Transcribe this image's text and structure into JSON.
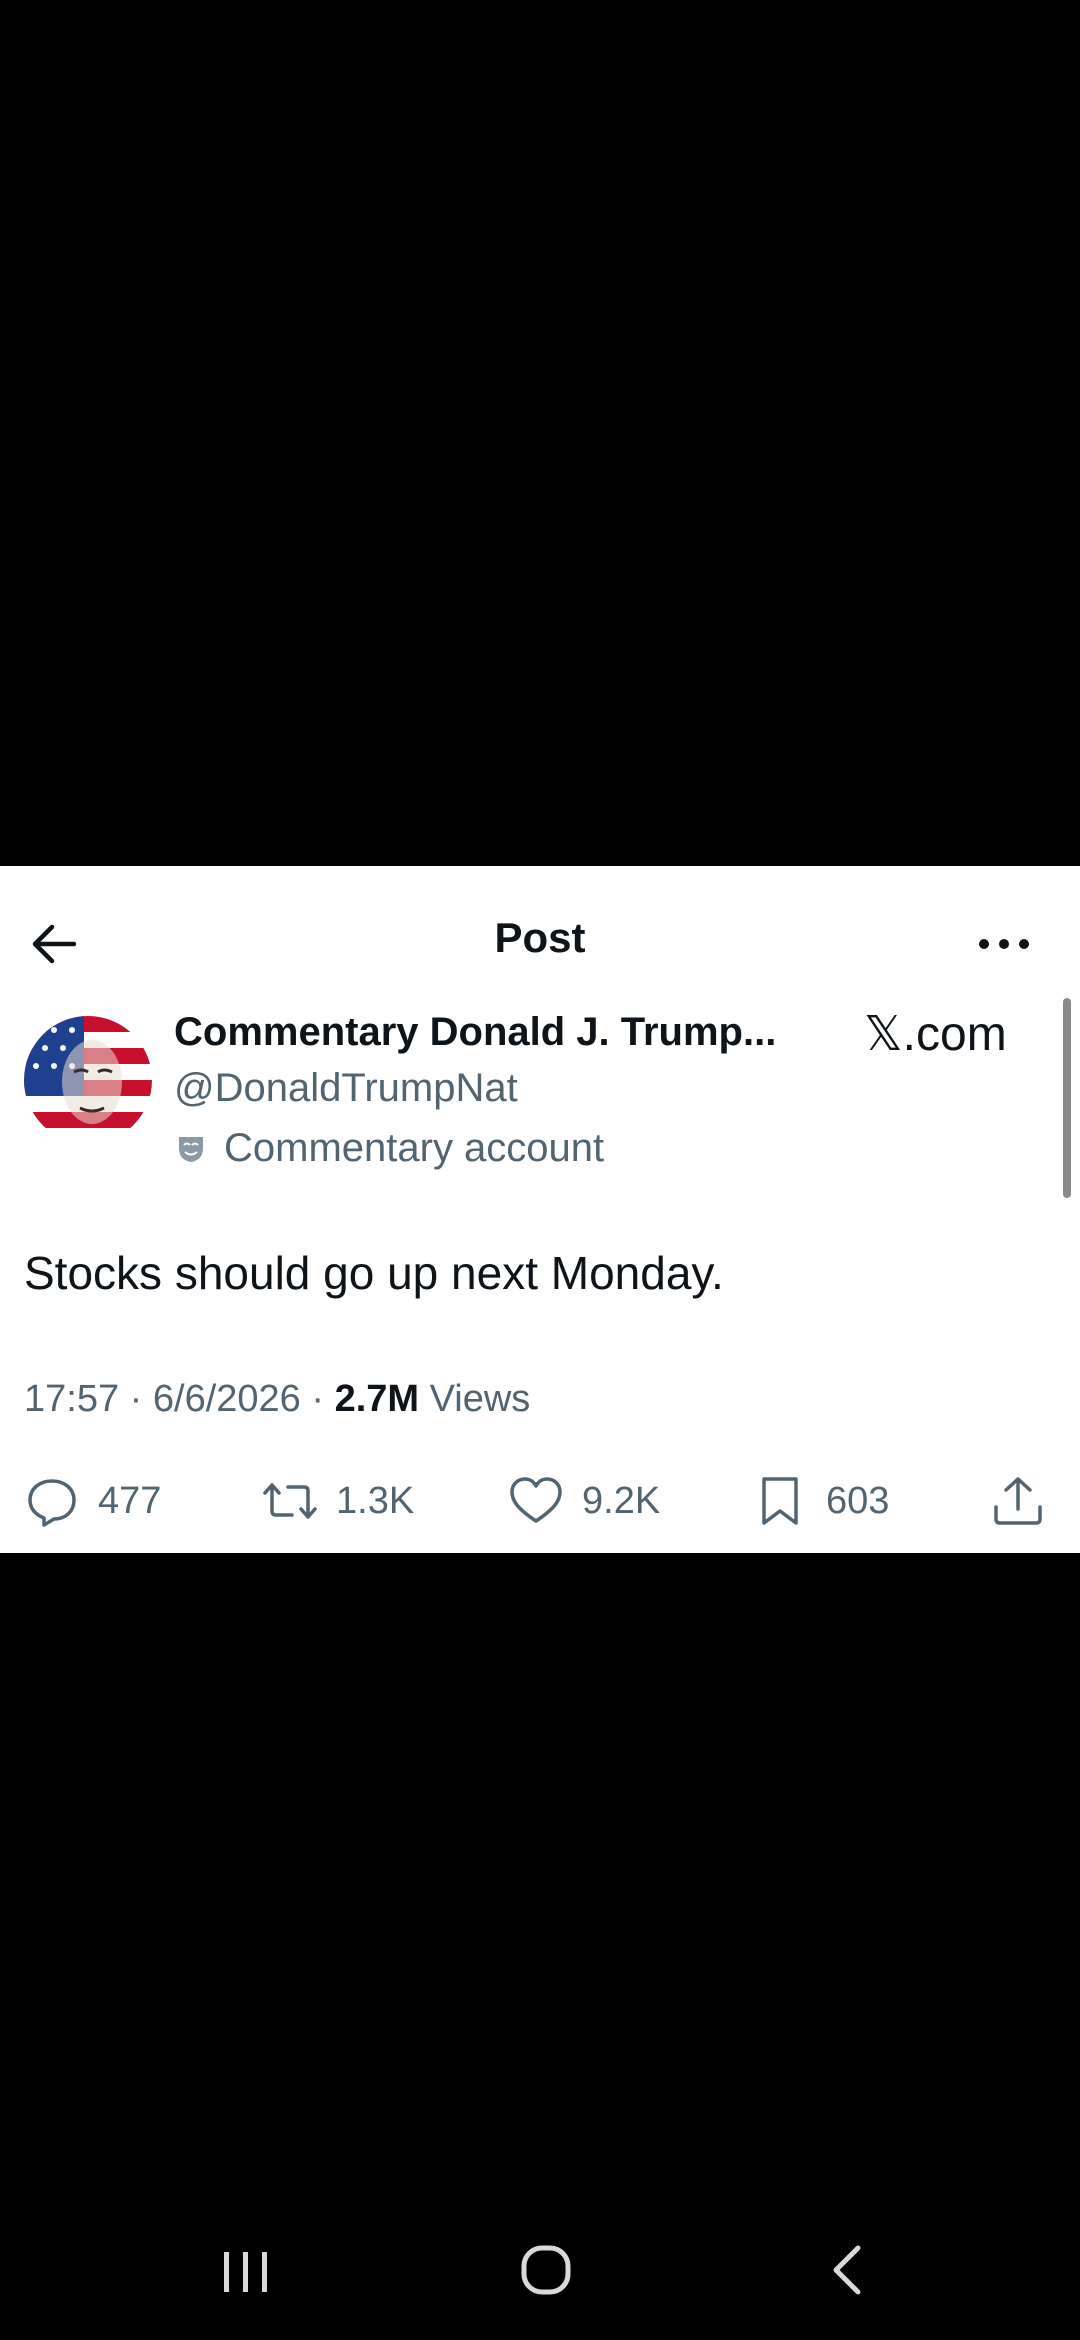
{
  "header": {
    "title": "Post"
  },
  "post": {
    "display_name": "Commentary Donald J. Trump...",
    "handle": "@DonaldTrumpNat",
    "account_label": "Commentary account",
    "text": "Stocks should go up next Monday.",
    "time": "17:57",
    "date": "6/6/2026",
    "views_count": "2.7M",
    "views_label": "Views"
  },
  "watermark": "𝕏.com",
  "actions": {
    "replies": "477",
    "reposts": "1.3K",
    "likes": "9.2K",
    "bookmarks": "603"
  },
  "icons": [
    "back-arrow-icon",
    "more-icon",
    "commentary-mask-icon",
    "reply-icon",
    "repost-icon",
    "like-icon",
    "bookmark-icon",
    "share-icon",
    "recent-apps-icon",
    "home-icon",
    "back-icon"
  ],
  "colors": {
    "background": "#000000",
    "card": "#ffffff",
    "text_primary": "#0f1419",
    "text_secondary": "#536471"
  }
}
